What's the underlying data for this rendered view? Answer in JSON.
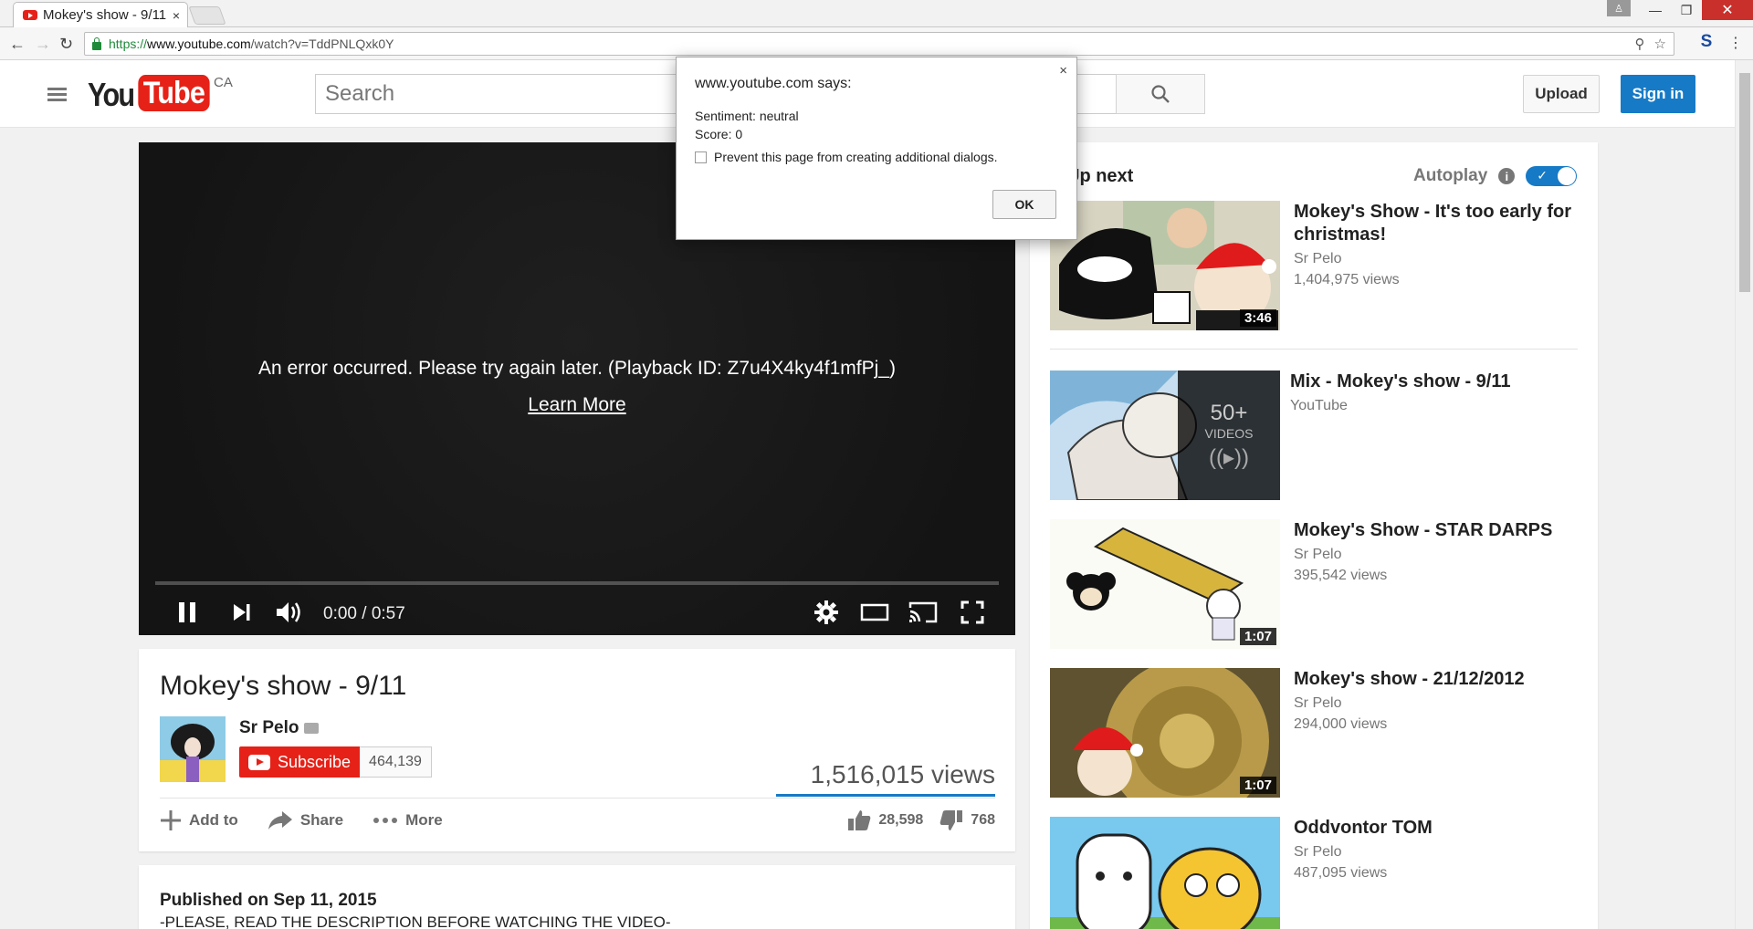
{
  "browser": {
    "tab_title": "Mokey's show - 9/11",
    "tab_close": "×",
    "url_scheme": "https://",
    "url_host": "www.youtube.com",
    "url_path": "/watch?v=TddPNLQxk0Y",
    "extension_label": "S"
  },
  "masthead": {
    "logo_you": "You",
    "logo_tube": "Tube",
    "region": "CA",
    "search_placeholder": "Search",
    "upload_label": "Upload",
    "signin_label": "Sign in"
  },
  "player": {
    "error_text": "An error occurred. Please try again later. (Playback ID: Z7u4X4ky4f1mfPj_)",
    "learn_more": "Learn More",
    "time": "0:00 / 0:57"
  },
  "video": {
    "title": "Mokey's show - 9/11",
    "channel": "Sr Pelo",
    "subscribe_label": "Subscribe",
    "subscriber_count": "464,139",
    "views": "1,516,015 views",
    "add_to": "Add to",
    "share": "Share",
    "more": "More",
    "likes": "28,598",
    "dislikes": "768",
    "published": "Published on Sep 11, 2015",
    "description_first_line": "-PLEASE, READ THE DESCRIPTION BEFORE WATCHING THE VIDEO-"
  },
  "sidebar": {
    "up_next": "Up next",
    "autoplay": "Autoplay",
    "items": [
      {
        "title": "Mokey's Show - It's too early for christmas!",
        "channel": "Sr Pelo",
        "views": "1,404,975 views",
        "duration": "3:46"
      },
      {
        "title": "Mix - Mokey's show - 9/11",
        "channel": "YouTube",
        "playlist_count": "50+",
        "playlist_label": "VIDEOS"
      },
      {
        "title": "Mokey's Show - STAR DARPS",
        "channel": "Sr Pelo",
        "views": "395,542 views",
        "duration": "1:07"
      },
      {
        "title": "Mokey's show - 21/12/2012",
        "channel": "Sr Pelo",
        "views": "294,000 views",
        "duration": "1:07"
      },
      {
        "title": "Oddvontor TOM",
        "channel": "Sr Pelo",
        "views": "487,095 views"
      }
    ]
  },
  "dialog": {
    "title": "www.youtube.com says:",
    "line1": "Sentiment: neutral",
    "line2": "Score: 0",
    "checkbox_label": "Prevent this page from creating additional dialogs.",
    "ok_label": "OK",
    "close": "×"
  }
}
